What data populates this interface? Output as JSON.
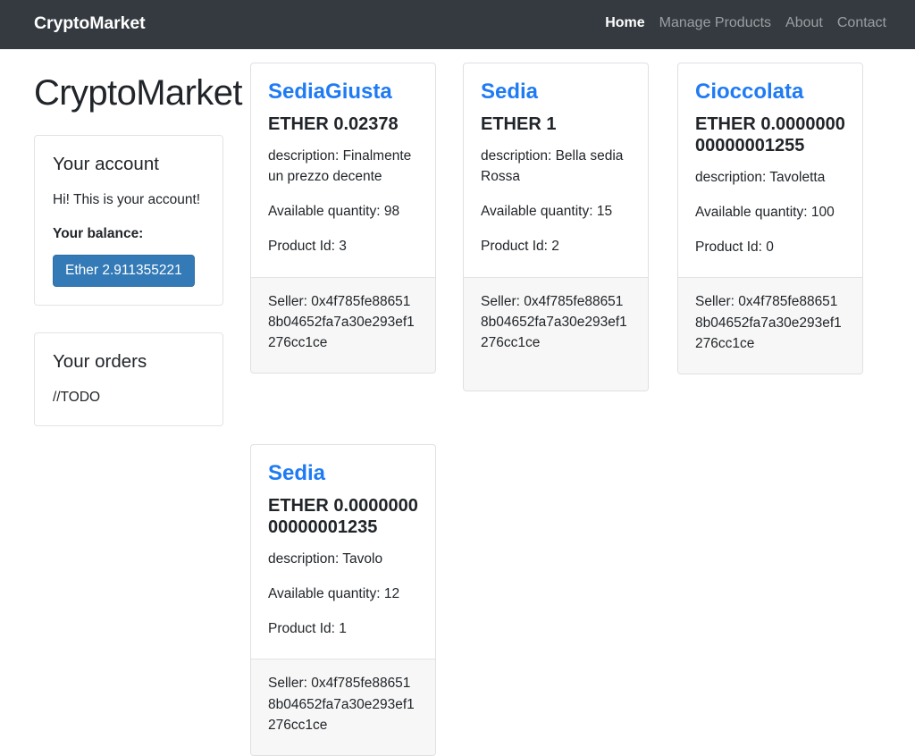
{
  "navbar": {
    "brand": "CryptoMarket",
    "links": [
      {
        "label": "Home",
        "active": true
      },
      {
        "label": "Manage Products",
        "active": false
      },
      {
        "label": "About",
        "active": false
      },
      {
        "label": "Contact",
        "active": false
      }
    ]
  },
  "page": {
    "title": "CryptoMarket"
  },
  "sidebar": {
    "account": {
      "heading": "Your account",
      "greeting": "Hi! This is your account!",
      "balance_label": "Your balance:",
      "balance_value": "Ether 2.911355221",
      "button_color": "#337ab7"
    },
    "orders": {
      "heading": "Your orders",
      "body": "//TODO"
    }
  },
  "labels": {
    "price_prefix": "ETHER",
    "description_prefix": "description:",
    "quantity_prefix": "Available quantity:",
    "product_id_prefix": "Product Id:",
    "seller_prefix": "Seller:"
  },
  "products": [
    {
      "name": "SediaGiusta",
      "price": "ETHER 0.02378",
      "description": "description: Finalmente un prezzo decente",
      "quantity": "Available quantity: 98",
      "product_id": "Product Id: 3",
      "seller": "Seller: 0x4f785fe886518b04652fa7a30e293ef1276cc1ce"
    },
    {
      "name": "Sedia",
      "price": "ETHER 1",
      "description": "description: Bella sedia Rossa",
      "quantity": "Available quantity: 15",
      "product_id": "Product Id: 2",
      "seller": "Seller: 0x4f785fe886518b04652fa7a30e293ef1276cc1ce"
    },
    {
      "name": "Cioccolata",
      "price": "ETHER 0.000000000000001255",
      "description": "description: Tavoletta",
      "quantity": "Available quantity: 100",
      "product_id": "Product Id: 0",
      "seller": "Seller: 0x4f785fe886518b04652fa7a30e293ef1276cc1ce"
    },
    {
      "name": "Sedia",
      "price": "ETHER 0.000000000000001235",
      "description": "description: Tavolo",
      "quantity": "Available quantity: 12",
      "product_id": "Product Id: 1",
      "seller": "Seller: 0x4f785fe886518b04652fa7a30e293ef1276cc1ce"
    }
  ]
}
